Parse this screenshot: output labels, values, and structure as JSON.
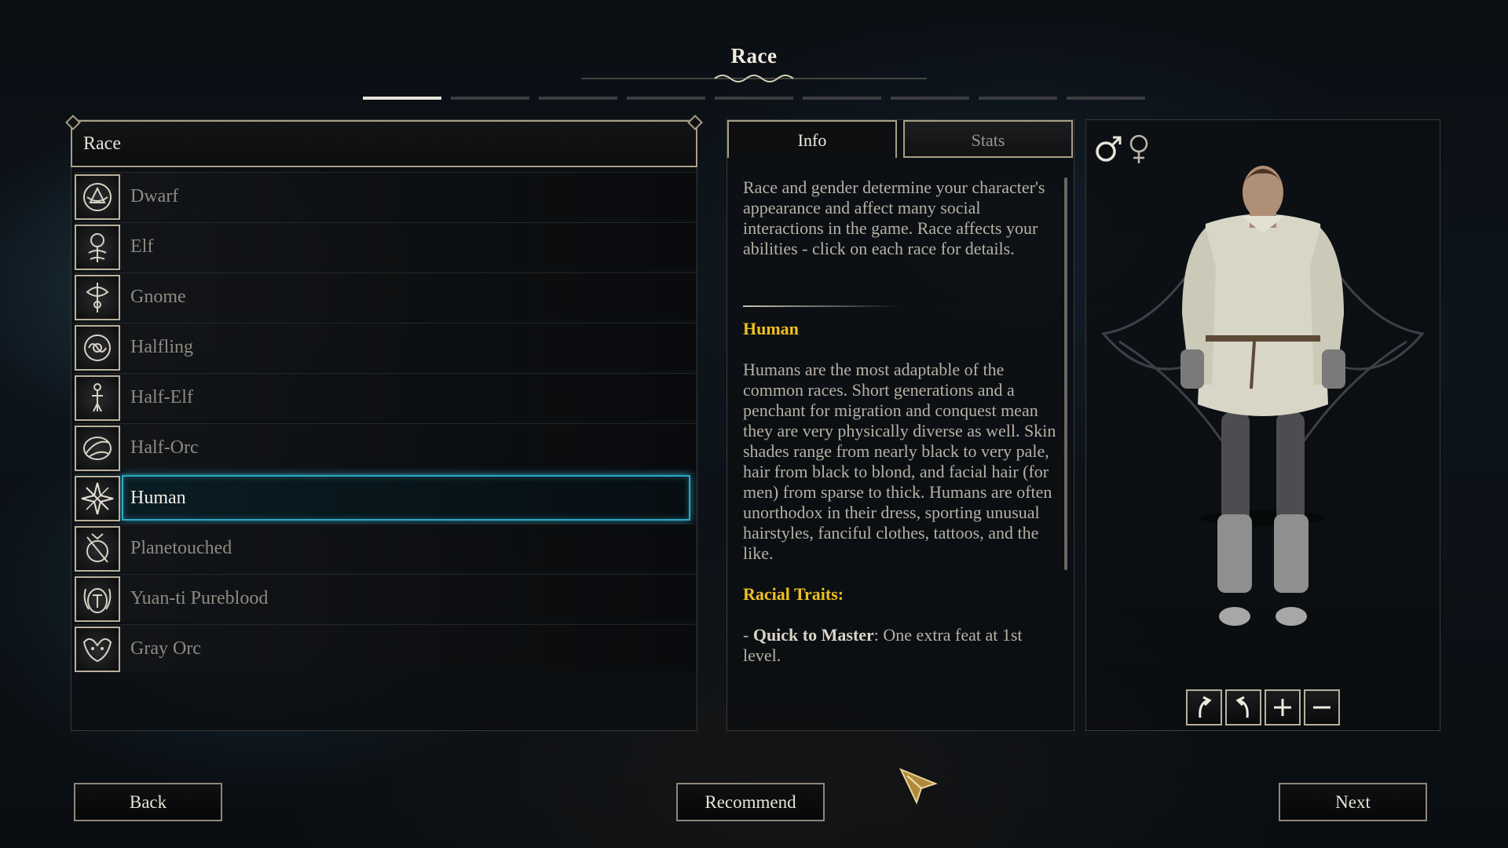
{
  "header": {
    "title": "Race"
  },
  "progress": {
    "total_steps": 9,
    "current_step": 1
  },
  "race_list": {
    "header_label": "Race",
    "items": [
      {
        "label": "Dwarf",
        "icon": "dwarf-emblem-icon"
      },
      {
        "label": "Elf",
        "icon": "elf-emblem-icon"
      },
      {
        "label": "Gnome",
        "icon": "gnome-emblem-icon"
      },
      {
        "label": "Halfling",
        "icon": "halfling-emblem-icon"
      },
      {
        "label": "Half-Elf",
        "icon": "half-elf-emblem-icon"
      },
      {
        "label": "Half-Orc",
        "icon": "half-orc-emblem-icon"
      },
      {
        "label": "Human",
        "icon": "human-emblem-icon"
      },
      {
        "label": "Planetouched",
        "icon": "planetouched-emblem-icon"
      },
      {
        "label": "Yuan-ti Pureblood",
        "icon": "yuan-ti-emblem-icon"
      },
      {
        "label": "Gray Orc",
        "icon": "gray-orc-emblem-icon"
      }
    ],
    "selected": "Human"
  },
  "tabs": {
    "info": "Info",
    "stats": "Stats",
    "active": "Info"
  },
  "info": {
    "intro": "Race and gender determine your character's appearance and affect many social interactions in the game. Race affects your abilities - click on each race for details.",
    "race_name": "Human",
    "description": "Humans are the most adaptable of the common races. Short generations and a penchant for migration and conquest mean they are very physically diverse as well. Skin shades range from nearly black to very pale, hair from black to blond, and facial hair (for men) from sparse to thick. Humans are often unorthodox in their dress, sporting unusual hairstyles, fanciful clothes, tattoos, and the like.",
    "traits_heading": "Racial Traits:",
    "trait_name": "Quick to Master",
    "trait_text": ": One extra feat at 1st level."
  },
  "preview": {
    "gender_icons": [
      "male-symbol-icon",
      "female-symbol-icon"
    ],
    "selected_gender": "male",
    "controls": [
      {
        "name": "rotate-left-button",
        "icon": "rotate-left-icon"
      },
      {
        "name": "rotate-right-button",
        "icon": "rotate-right-icon"
      },
      {
        "name": "zoom-in-button",
        "icon": "plus-icon"
      },
      {
        "name": "zoom-out-button",
        "icon": "minus-icon"
      }
    ]
  },
  "buttons": {
    "back": "Back",
    "recommend": "Recommend",
    "next": "Next"
  },
  "colors": {
    "accent_gold": "#f0c020",
    "selection_cyan": "#2ea8c4",
    "frame": "#a79e88"
  }
}
